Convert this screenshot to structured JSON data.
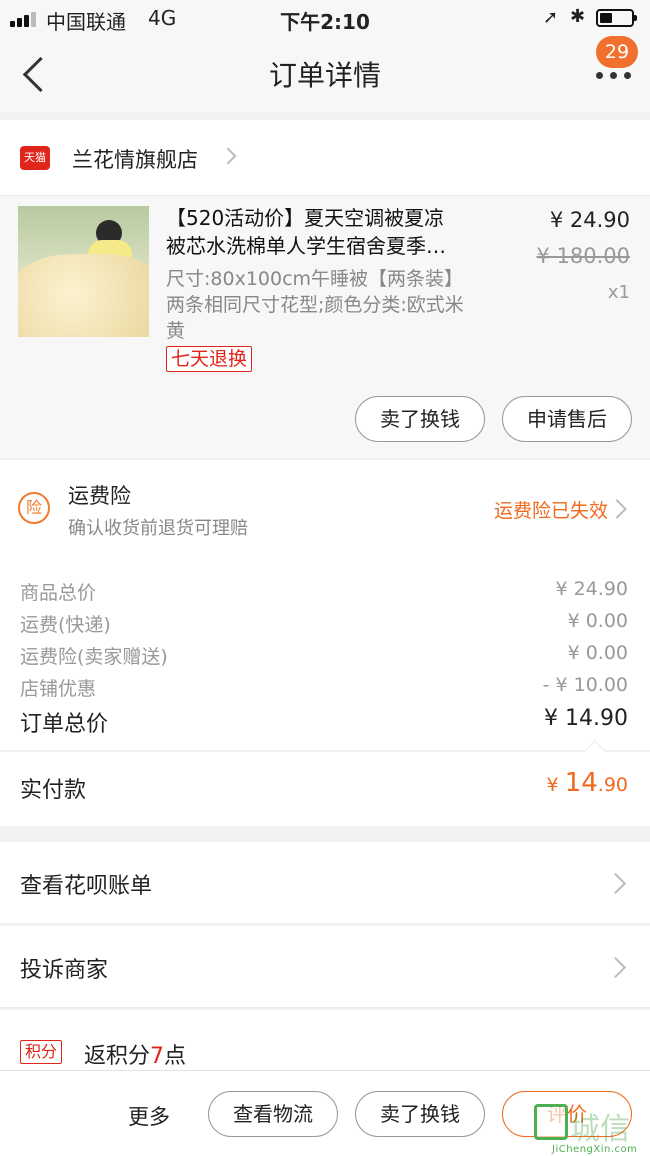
{
  "status_bar": {
    "carrier": "中国联通",
    "network": "4G",
    "time": "下午2:10",
    "location_icon": "location-arrow-icon",
    "bluetooth_icon": "bluetooth-icon",
    "battery_level": 0.4
  },
  "nav": {
    "title": "订单详情",
    "badge": "29",
    "back_icon": "chevron-left-icon",
    "more_icon": "more-dots-icon"
  },
  "shop": {
    "icon_text": "天猫",
    "name": "兰花情旗舰店"
  },
  "product": {
    "title_line1": "【520活动价】夏天空调被夏凉",
    "title_line2": "被芯水洗棉单人学生宿舍夏季…",
    "spec_line1": "尺寸:80x100cm午睡被【两条装】",
    "spec_line2": "两条相同尺寸花型;颜色分类:欧式米",
    "spec_line3": "黄",
    "tag": "七天退换",
    "price": "¥ 24.90",
    "original_price": "¥ 180.00",
    "quantity": "x1",
    "sell_button": "卖了换钱",
    "after_sale_button": "申请售后"
  },
  "freight_insurance": {
    "icon_text": "险",
    "title": "运费险",
    "description": "确认收货前退货可理赔",
    "status": "运费险已失效"
  },
  "summary": {
    "rows": [
      {
        "label": "商品总价",
        "value": "¥ 24.90"
      },
      {
        "label": "运费(快递)",
        "value": "¥ 0.00"
      },
      {
        "label": "运费险(卖家赠送)",
        "value": "¥ 0.00"
      },
      {
        "label": "店铺优惠",
        "value": "- ¥ 10.00"
      }
    ],
    "total_label": "订单总价",
    "total_value": "¥ 14.90"
  },
  "paid": {
    "label": "实付款",
    "currency": "¥ ",
    "integer": "14",
    "decimal": ".90"
  },
  "menu": {
    "huabei": "查看花呗账单",
    "complain": "投诉商家"
  },
  "points": {
    "badge": "积分",
    "prefix": "返积分",
    "count": "7",
    "suffix": "点"
  },
  "bottom_bar": {
    "more": "更多",
    "logistics": "查看物流",
    "sell": "卖了换钱",
    "review": "评价"
  },
  "watermark": {
    "text": "城信",
    "url": "JiChengXin.com"
  },
  "colors": {
    "accent_orange": "#ef6a1f",
    "tmall_red": "#e1251b",
    "badge_orange": "#f0702e"
  }
}
